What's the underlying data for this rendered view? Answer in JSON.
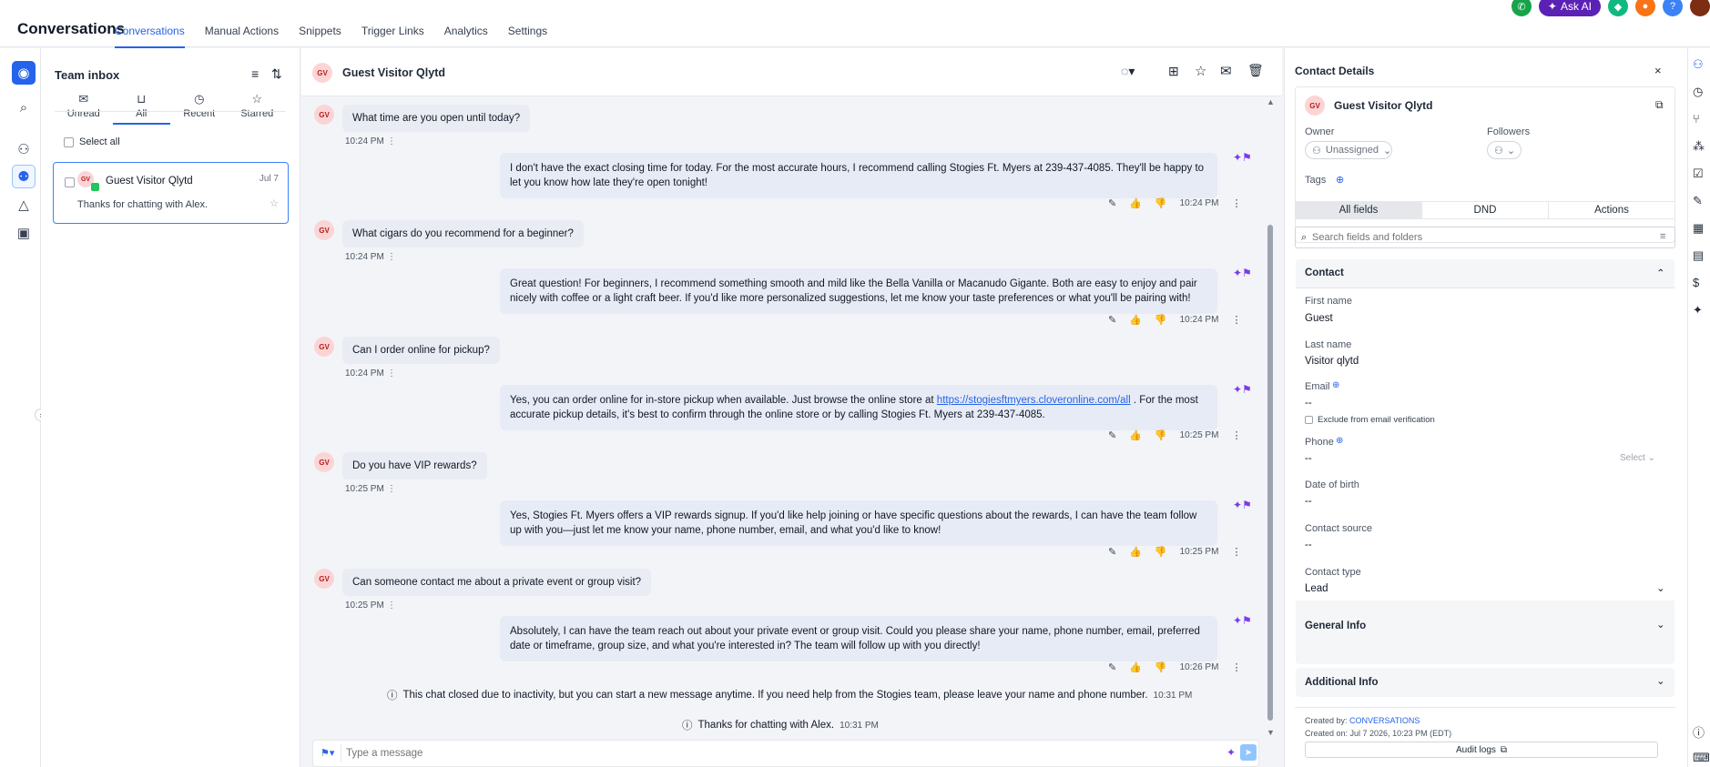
{
  "app": {
    "title": "Conversations"
  },
  "topnav": [
    "Conversations",
    "Manual Actions",
    "Snippets",
    "Trigger Links",
    "Analytics",
    "Settings"
  ],
  "topright": {
    "ask_ai": "Ask AI"
  },
  "inbox": {
    "title": "Team inbox",
    "tabs": [
      "Unread",
      "All",
      "Recent",
      "Starred"
    ],
    "select_all": "Select all",
    "conversation": {
      "initials": "GV",
      "name": "Guest Visitor Qlytd",
      "date": "Jul 7",
      "preview": "Thanks for chatting with Alex."
    }
  },
  "chat": {
    "initials": "GV",
    "contact_name": "Guest Visitor Qlytd",
    "messages": [
      {
        "q": "What time are you open until today?",
        "q_time": "10:24 PM",
        "a": "I don't have the exact closing time for today. For the most accurate hours, I recommend calling Stogies Ft. Myers at 239-437-4085. They'll be happy to let you know how late they're open tonight!",
        "a_time": "10:24 PM"
      },
      {
        "q": "What cigars do you recommend for a beginner?",
        "q_time": "10:24 PM",
        "a": "Great question! For beginners, I recommend something smooth and mild like the Bella Vanilla or Macanudo Gigante. Both are easy to enjoy and pair nicely with coffee or a light craft beer. If you'd like more personalized suggestions, let me know your taste preferences or what you'll be pairing with!",
        "a_time": "10:24 PM"
      },
      {
        "q": "Can I order online for pickup?",
        "q_time": "10:24 PM",
        "a_pre": "Yes, you can order online for in-store pickup when available. Just browse the online store at ",
        "a_link": "https://stogiesftmyers.cloveronline.com/all",
        "a_post": " . For the most accurate pickup details, it's best to confirm through the online store or by calling Stogies Ft. Myers at 239-437-4085.",
        "a_time": "10:25 PM"
      },
      {
        "q": "Do you have VIP rewards?",
        "q_time": "10:25 PM",
        "a": "Yes, Stogies Ft. Myers offers a VIP rewards signup. If you'd like help joining or have specific questions about the rewards, I can have the team follow up with you—just let me know your name, phone number, email, and what you'd like to know!",
        "a_time": "10:25 PM"
      },
      {
        "q": "Can someone contact me about a private event or group visit?",
        "q_time": "10:25 PM",
        "a": "Absolutely, I can have the team reach out about your private event or group visit. Could you please share your name, phone number, email, preferred date or timeframe, group size, and what you're interested in? The team will follow up with you directly!",
        "a_time": "10:26 PM"
      }
    ],
    "system1": {
      "text": "This chat closed due to inactivity, but you can start a new message anytime. If you need help from the Stogies team, please leave your name and phone number.",
      "time": "10:31 PM"
    },
    "system2": {
      "text": "Thanks for chatting with Alex.",
      "time": "10:31 PM"
    },
    "composer_placeholder": "Type a message"
  },
  "contact_panel": {
    "title": "Contact Details",
    "initials": "GV",
    "name": "Guest Visitor Qlytd",
    "owner_label": "Owner",
    "owner_value": "Unassigned",
    "followers_label": "Followers",
    "tags_label": "Tags",
    "tabs": [
      "All fields",
      "DND",
      "Actions"
    ],
    "search_placeholder": "Search fields and folders",
    "contact_section": "Contact",
    "first_name_label": "First name",
    "first_name": "Guest",
    "last_name_label": "Last name",
    "last_name": "Visitor qlytd",
    "email_label": "Email",
    "email": "--",
    "exclude_label": "Exclude from email verification",
    "phone_label": "Phone",
    "phone": "--",
    "phone_select": "Select",
    "dob_label": "Date of birth",
    "dob": "--",
    "source_label": "Contact source",
    "source": "--",
    "type_label": "Contact type",
    "type": "Lead",
    "general_info": "General Info",
    "additional_info": "Additional Info",
    "created_by_label": "Created by:",
    "created_by": "CONVERSATIONS",
    "created_on": "Created on: Jul 7 2026, 10:23 PM (EDT)",
    "audit_logs": "Audit logs"
  }
}
